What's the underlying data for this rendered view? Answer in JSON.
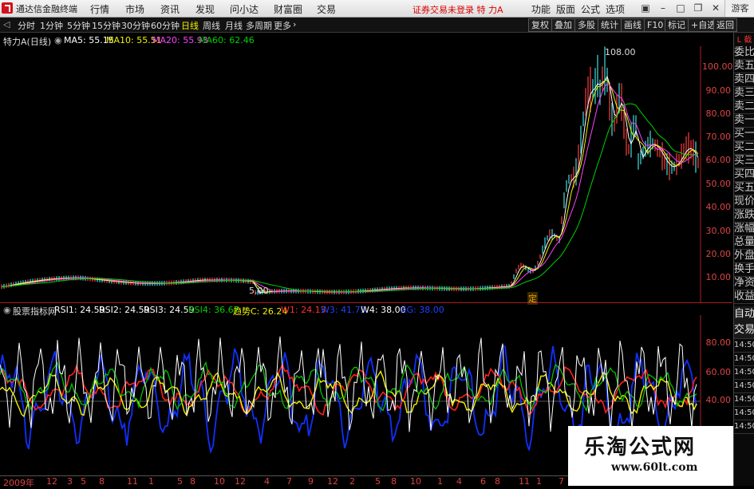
{
  "app": {
    "title": "通达信金融终端"
  },
  "menu": [
    "行情",
    "市场",
    "资讯",
    "发现",
    "问小达",
    "财富圈",
    "交易"
  ],
  "warning": "证券交易未登录  特 力A",
  "right_menu": [
    "功能",
    "版面",
    "公式",
    "选项"
  ],
  "guest": "游客",
  "toolbar": {
    "periods": [
      "分时",
      "1分钟",
      "5分钟",
      "15分钟",
      "30分钟",
      "60分钟",
      "日线",
      "周线",
      "月线",
      "多周期",
      "更多"
    ],
    "active": "日线",
    "right": [
      "复权",
      "叠加",
      "多股",
      "统计",
      "画线",
      "F10",
      "标记",
      "+自选",
      "返回"
    ]
  },
  "main_info": {
    "name": "特力A(日线)",
    "ma5": "MA5: 55.15",
    "ma10": "MA10: 55.51",
    "ma20": "MA20: 55.93",
    "ma60": "MA60: 62.46",
    "colors": {
      "ma5": "#ffffff",
      "ma10": "#f0f000",
      "ma20": "#ff40ff",
      "ma60": "#00d000"
    }
  },
  "main_axis": [
    "100.00",
    "90.00",
    "80.00",
    "70.00",
    "60.00",
    "50.00",
    "40.00",
    "30.00",
    "20.00",
    "10.00"
  ],
  "peak_label": "108.00",
  "low_label": "5.00",
  "marker": "定",
  "sub_info": {
    "name": "股票指标网",
    "rsi1": "RSI1: 24.59",
    "rsi2": "RSI2: 24.59",
    "rsi3": "RSI3: 24.59",
    "rsi4": "RSI4: 36.67",
    "trend": "趋势C: 26.24",
    "w1": "W1: 24.13",
    "w3": "W3: 41.73",
    "w4": "W4: 38.00",
    "xg": "XG: 38.00"
  },
  "sub_axis": [
    "80.00",
    "60.00",
    "40.00"
  ],
  "sidebar": [
    "委比",
    "卖五",
    "卖四",
    "卖三",
    "卖二",
    "卖一",
    "买一",
    "买二",
    "买三",
    "买四",
    "买五",
    "现价",
    "涨跌",
    "涨幅",
    "总量",
    "外盘",
    "换手",
    "净资",
    "收益"
  ],
  "sidebar_top": "L 截",
  "sidebar2": [
    "自动",
    "交易"
  ],
  "sidebar_times": [
    "14:50",
    "14:50",
    "14:50",
    "14:50",
    "14:50",
    "14:50",
    "14:50"
  ],
  "xaxis": [
    "2009年",
    "12",
    "3",
    "5",
    "8",
    "11",
    "1",
    "5",
    "8",
    "10",
    "12",
    "4",
    "7",
    "9",
    "12",
    "2",
    "5",
    "8",
    "10",
    "1",
    "4",
    "6",
    "8",
    "11",
    "1",
    "7"
  ],
  "watermark": {
    "title": "乐淘公式网",
    "url": "www.60lt.com"
  }
}
